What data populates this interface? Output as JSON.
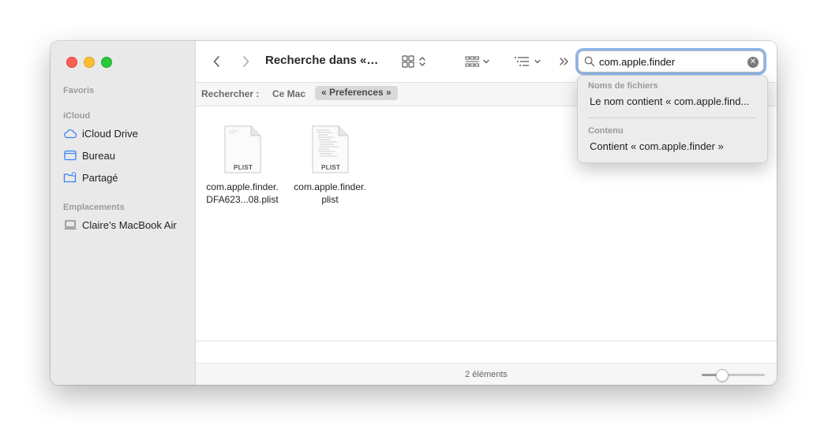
{
  "sidebar": {
    "sections": {
      "favoris": "Favoris",
      "icloud": "iCloud",
      "emplacements": "Emplacements"
    },
    "items": [
      {
        "label": "iCloud Drive",
        "icon": "cloud-icon"
      },
      {
        "label": "Bureau",
        "icon": "desktop-icon"
      },
      {
        "label": "Partagé",
        "icon": "shared-folder-icon"
      },
      {
        "label": "Claire’s MacBook Air",
        "icon": "laptop-icon"
      }
    ]
  },
  "toolbar": {
    "title": "Recherche dans «…",
    "back_icon": "chevron-left-icon",
    "forward_icon": "chevron-right-icon",
    "view_icon": "grid-view-icon",
    "group_icon": "group-icon",
    "sort_icon": "list-sort-icon",
    "more_icon": "double-chevron-icon"
  },
  "search": {
    "value": "com.apple.finder",
    "clear_icon": "clear-icon"
  },
  "scope": {
    "label": "Rechercher :",
    "this_mac": "Ce Mac",
    "preferences": "« Preferences »"
  },
  "files": [
    {
      "line1": "com.apple.finder.",
      "line2": "DFA623...08.plist",
      "badge": "PLIST"
    },
    {
      "line1": "com.apple.finder.",
      "line2": "plist",
      "badge": "PLIST"
    }
  ],
  "status": {
    "count_text": "2 éléments",
    "icon_size_fraction": 0.27
  },
  "suggestions": {
    "filenames_header": "Noms de fichiers",
    "filename_item": "Le nom contient « com.apple.find...",
    "content_header": "Contenu",
    "content_item": "Contient « com.apple.finder »"
  }
}
